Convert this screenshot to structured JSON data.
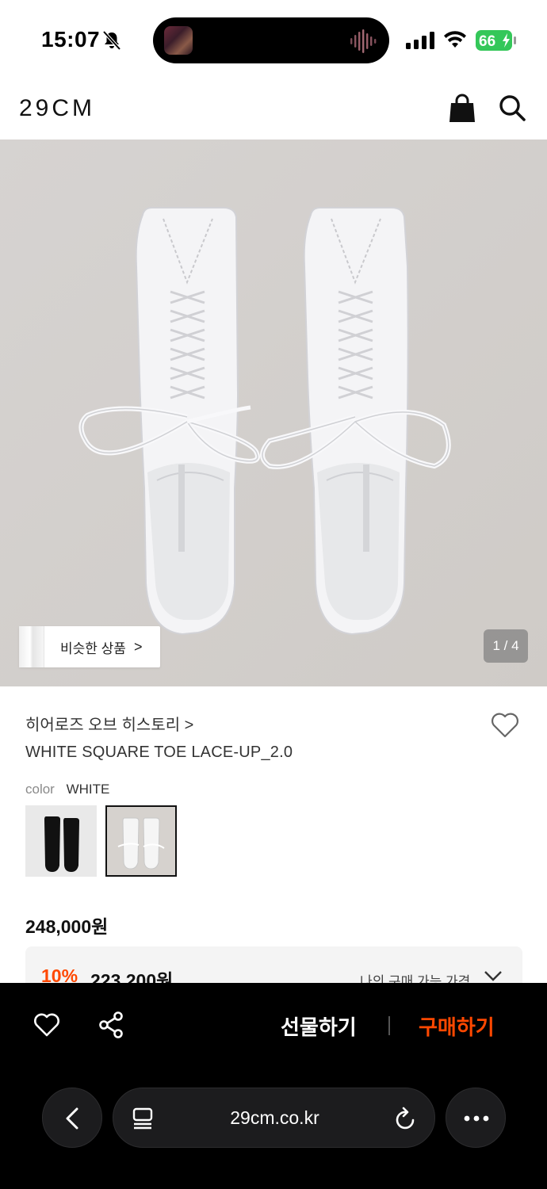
{
  "status_bar": {
    "time": "15:07",
    "battery": "66"
  },
  "header": {
    "logo": "29CM"
  },
  "hero": {
    "similar_label": "비슷한 상품",
    "similar_chevron": ">",
    "page_counter": "1 / 4"
  },
  "product": {
    "brand": "히어로즈 오브 히스토리 >",
    "name": "WHITE SQUARE TOE LACE-UP_2.0",
    "color_label": "color",
    "color_value": "WHITE",
    "price": "248,000원",
    "discount_percent": "10%",
    "discount_price": "223,200원",
    "my_price_label": "나의 구매 가능 가격"
  },
  "bottom_bar": {
    "gift_label": "선물하기",
    "buy_label": "구매하기"
  },
  "browser": {
    "url": "29cm.co.kr"
  },
  "colors": {
    "accent": "#ff4800",
    "bar_bg": "#000000",
    "hero_bg": "#d8d5d2"
  },
  "icons": [
    "bell-slash-icon",
    "signal-icon",
    "wifi-icon",
    "battery-icon",
    "cart-icon",
    "search-icon",
    "heart-icon",
    "share-icon",
    "back-icon",
    "reader-icon",
    "reload-icon",
    "more-icon"
  ]
}
